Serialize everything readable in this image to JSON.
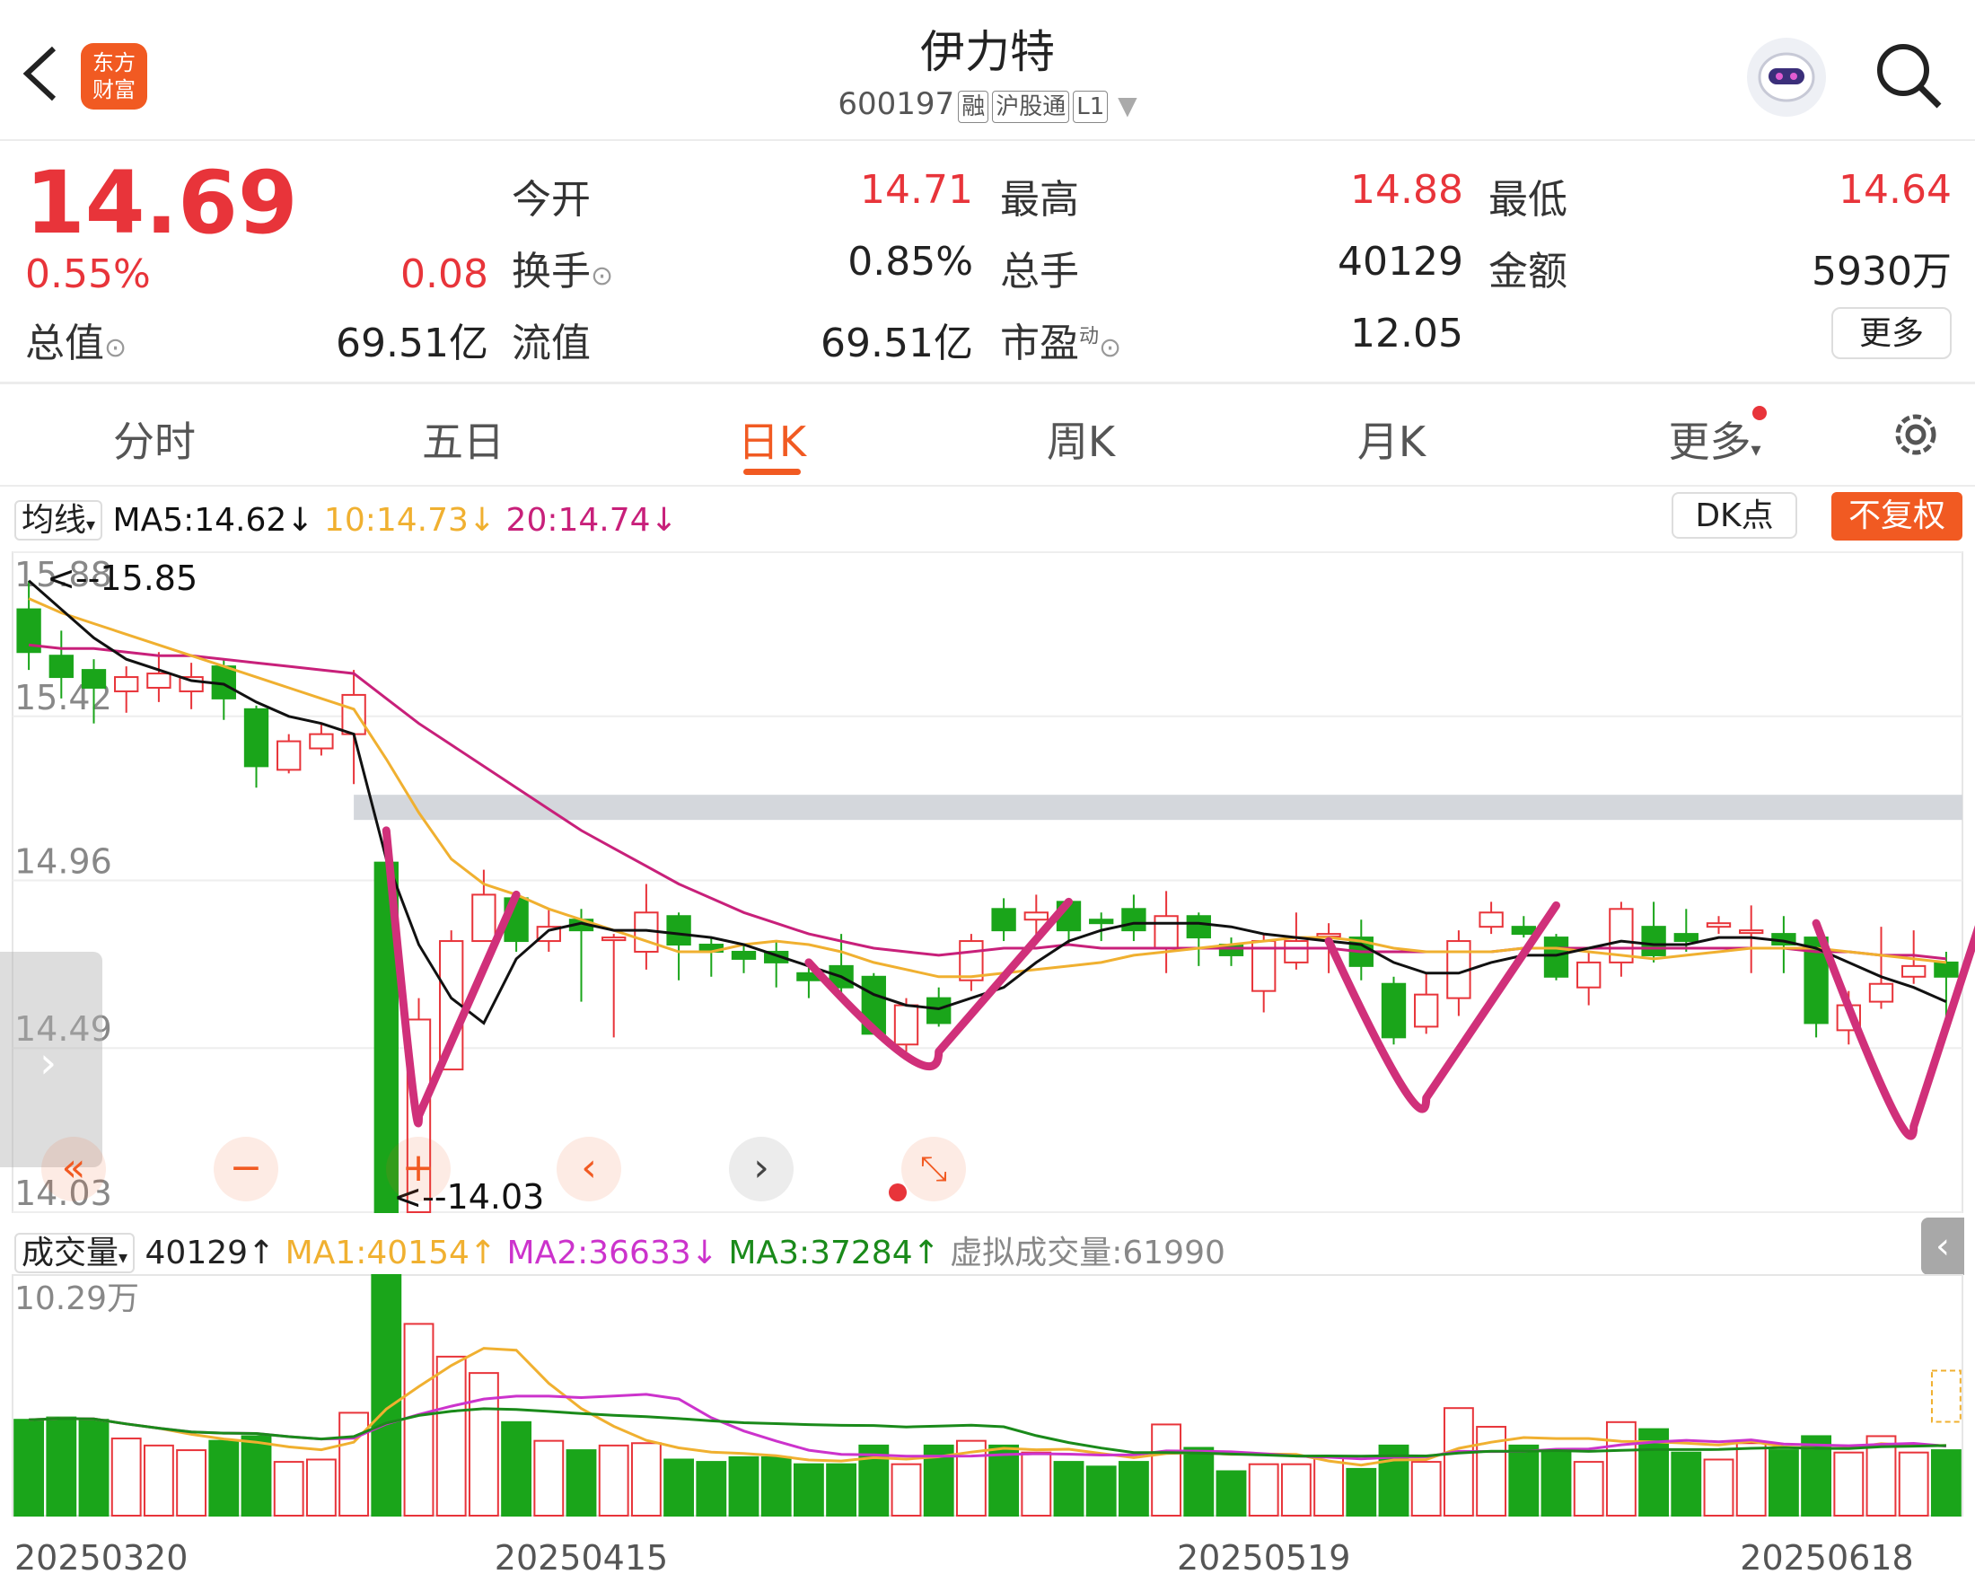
{
  "header": {
    "title": "伊力特",
    "code": "600197",
    "tags": [
      "融",
      "沪股通",
      "L1"
    ],
    "logo_text_1": "东方",
    "logo_text_2": "财富"
  },
  "quote": {
    "price": "14.69",
    "change_pct": "0.55%",
    "change": "0.08",
    "total_value_label": "总值",
    "total_value": "69.51亿",
    "fields": [
      {
        "label": "今开",
        "value": "14.71",
        "color": "red"
      },
      {
        "label": "最高",
        "value": "14.88",
        "color": "red"
      },
      {
        "label": "最低",
        "value": "14.64",
        "color": "red"
      },
      {
        "label": "换手",
        "value": "0.85%",
        "color": "dark"
      },
      {
        "label": "总手",
        "value": "40129",
        "color": "dark"
      },
      {
        "label": "金额",
        "value": "5930万",
        "color": "dark"
      },
      {
        "label": "流值",
        "value": "69.51亿",
        "color": "dark"
      },
      {
        "label": "市盈",
        "value": "12.05",
        "color": "dark"
      }
    ],
    "pe_superscript": "动",
    "more_button": "更多"
  },
  "tabs": [
    {
      "label": "分时",
      "active": false
    },
    {
      "label": "五日",
      "active": false
    },
    {
      "label": "日K",
      "active": true
    },
    {
      "label": "周K",
      "active": false
    },
    {
      "label": "月K",
      "active": false
    },
    {
      "label": "更多",
      "active": false
    }
  ],
  "kline_legend": {
    "selector": "均线",
    "ma5": "MA5:14.62↓",
    "ma10": "10:14.73↓",
    "ma20": "20:14.74↓",
    "dk_button": "DK点",
    "adjust_button": "不复权"
  },
  "volume_legend": {
    "selector": "成交量",
    "vol": "40129↑",
    "ma1": "MA1:40154↑",
    "ma2": "MA2:36633↓",
    "ma3": "MA3:37284↑",
    "virtual": "虚拟成交量:61990"
  },
  "colors": {
    "up": "#e8343a",
    "down": "#1aa51a",
    "ma5": "#111111",
    "ma10": "#f0b030",
    "ma20": "#c8207a",
    "vol_ma2": "#cc33cc",
    "accent": "#f15a22",
    "annotation": "#d0307a"
  },
  "chart_data": {
    "type": "candlestick",
    "y_ticks": [
      "15.88",
      "15.42",
      "14.96",
      "14.49",
      "14.03"
    ],
    "ylim": [
      14.03,
      15.88
    ],
    "high_marker": "15.85",
    "low_marker": "14.03",
    "volume_max_label": "10.29万",
    "volume_max": 102900,
    "dates": [
      "20250320",
      "20250415",
      "20250519",
      "20250618"
    ],
    "candles": [
      {
        "o": 15.72,
        "c": 15.6,
        "h": 15.8,
        "l": 15.55,
        "v": 41000
      },
      {
        "o": 15.59,
        "c": 15.53,
        "h": 15.66,
        "l": 15.47,
        "v": 42000
      },
      {
        "o": 15.55,
        "c": 15.5,
        "h": 15.58,
        "l": 15.4,
        "v": 41000
      },
      {
        "o": 15.49,
        "c": 15.53,
        "h": 15.56,
        "l": 15.43,
        "v": 33000
      },
      {
        "o": 15.5,
        "c": 15.54,
        "h": 15.6,
        "l": 15.46,
        "v": 30000
      },
      {
        "o": 15.49,
        "c": 15.53,
        "h": 15.57,
        "l": 15.44,
        "v": 28000
      },
      {
        "o": 15.56,
        "c": 15.47,
        "h": 15.58,
        "l": 15.41,
        "v": 32000
      },
      {
        "o": 15.44,
        "c": 15.28,
        "h": 15.45,
        "l": 15.22,
        "v": 34000
      },
      {
        "o": 15.27,
        "c": 15.35,
        "h": 15.37,
        "l": 15.26,
        "v": 23000
      },
      {
        "o": 15.33,
        "c": 15.37,
        "h": 15.4,
        "l": 15.31,
        "v": 24000
      },
      {
        "o": 15.37,
        "c": 15.48,
        "h": 15.55,
        "l": 15.23,
        "v": 44000
      },
      {
        "o": 15.01,
        "c": 14.03,
        "h": 15.07,
        "l": 14.03,
        "v": 102900
      },
      {
        "o": 14.03,
        "c": 14.57,
        "h": 14.63,
        "l": 14.03,
        "v": 82000
      },
      {
        "o": 14.43,
        "c": 14.79,
        "h": 14.82,
        "l": 14.43,
        "v": 68000
      },
      {
        "o": 14.79,
        "c": 14.92,
        "h": 14.99,
        "l": 14.79,
        "v": 61000
      },
      {
        "o": 14.91,
        "c": 14.79,
        "h": 14.93,
        "l": 14.76,
        "v": 40000
      },
      {
        "o": 14.79,
        "c": 14.83,
        "h": 14.88,
        "l": 14.76,
        "v": 32000
      },
      {
        "o": 14.85,
        "c": 14.82,
        "h": 14.88,
        "l": 14.62,
        "v": 28000
      },
      {
        "o": 14.8,
        "c": 14.8,
        "h": 14.81,
        "l": 14.52,
        "v": 30000
      },
      {
        "o": 14.76,
        "c": 14.87,
        "h": 14.95,
        "l": 14.71,
        "v": 31000
      },
      {
        "o": 14.86,
        "c": 14.78,
        "h": 14.87,
        "l": 14.68,
        "v": 24000
      },
      {
        "o": 14.78,
        "c": 14.76,
        "h": 14.8,
        "l": 14.69,
        "v": 23000
      },
      {
        "o": 14.76,
        "c": 14.74,
        "h": 14.78,
        "l": 14.7,
        "v": 25000
      },
      {
        "o": 14.76,
        "c": 14.73,
        "h": 14.79,
        "l": 14.66,
        "v": 25000
      },
      {
        "o": 14.7,
        "c": 14.68,
        "h": 14.73,
        "l": 14.63,
        "v": 22000
      },
      {
        "o": 14.72,
        "c": 14.66,
        "h": 14.81,
        "l": 14.62,
        "v": 22000
      },
      {
        "o": 14.69,
        "c": 14.53,
        "h": 14.7,
        "l": 14.53,
        "v": 30000
      },
      {
        "o": 14.5,
        "c": 14.61,
        "h": 14.63,
        "l": 14.48,
        "v": 22000
      },
      {
        "o": 14.63,
        "c": 14.56,
        "h": 14.66,
        "l": 14.55,
        "v": 30000
      },
      {
        "o": 14.68,
        "c": 14.79,
        "h": 14.81,
        "l": 14.65,
        "v": 32000
      },
      {
        "o": 14.88,
        "c": 14.82,
        "h": 14.91,
        "l": 14.79,
        "v": 30000
      },
      {
        "o": 14.85,
        "c": 14.87,
        "h": 14.92,
        "l": 14.8,
        "v": 27000
      },
      {
        "o": 14.9,
        "c": 14.82,
        "h": 14.91,
        "l": 14.78,
        "v": 23000
      },
      {
        "o": 14.85,
        "c": 14.84,
        "h": 14.87,
        "l": 14.79,
        "v": 21000
      },
      {
        "o": 14.88,
        "c": 14.82,
        "h": 14.92,
        "l": 14.79,
        "v": 23000
      },
      {
        "o": 14.77,
        "c": 14.86,
        "h": 14.93,
        "l": 14.7,
        "v": 39000
      },
      {
        "o": 14.86,
        "c": 14.8,
        "h": 14.87,
        "l": 14.72,
        "v": 29000
      },
      {
        "o": 14.78,
        "c": 14.75,
        "h": 14.8,
        "l": 14.72,
        "v": 19000
      },
      {
        "o": 14.65,
        "c": 14.79,
        "h": 14.81,
        "l": 14.59,
        "v": 22000
      },
      {
        "o": 14.73,
        "c": 14.79,
        "h": 14.87,
        "l": 14.71,
        "v": 22000
      },
      {
        "o": 14.81,
        "c": 14.81,
        "h": 14.84,
        "l": 14.7,
        "v": 25000
      },
      {
        "o": 14.8,
        "c": 14.72,
        "h": 14.85,
        "l": 14.68,
        "v": 20000
      },
      {
        "o": 14.67,
        "c": 14.52,
        "h": 14.69,
        "l": 14.5,
        "v": 30000
      },
      {
        "o": 14.55,
        "c": 14.64,
        "h": 14.7,
        "l": 14.53,
        "v": 23000
      },
      {
        "o": 14.63,
        "c": 14.79,
        "h": 14.82,
        "l": 14.58,
        "v": 46000
      },
      {
        "o": 14.83,
        "c": 14.87,
        "h": 14.9,
        "l": 14.81,
        "v": 38000
      },
      {
        "o": 14.83,
        "c": 14.81,
        "h": 14.86,
        "l": 14.8,
        "v": 30000
      },
      {
        "o": 14.8,
        "c": 14.69,
        "h": 14.81,
        "l": 14.68,
        "v": 28000
      },
      {
        "o": 14.66,
        "c": 14.73,
        "h": 14.76,
        "l": 14.61,
        "v": 23000
      },
      {
        "o": 14.73,
        "c": 14.88,
        "h": 14.9,
        "l": 14.69,
        "v": 40000
      },
      {
        "o": 14.83,
        "c": 14.75,
        "h": 14.9,
        "l": 14.73,
        "v": 37000
      },
      {
        "o": 14.81,
        "c": 14.79,
        "h": 14.88,
        "l": 14.76,
        "v": 27000
      },
      {
        "o": 14.83,
        "c": 14.84,
        "h": 14.86,
        "l": 14.81,
        "v": 24000
      },
      {
        "o": 14.82,
        "c": 14.82,
        "h": 14.89,
        "l": 14.7,
        "v": 31000
      },
      {
        "o": 14.81,
        "c": 14.78,
        "h": 14.86,
        "l": 14.7,
        "v": 28000
      },
      {
        "o": 14.8,
        "c": 14.56,
        "h": 14.8,
        "l": 14.52,
        "v": 34000
      },
      {
        "o": 14.54,
        "c": 14.61,
        "h": 14.65,
        "l": 14.5,
        "v": 27000
      },
      {
        "o": 14.62,
        "c": 14.67,
        "h": 14.83,
        "l": 14.6,
        "v": 34000
      },
      {
        "o": 14.69,
        "c": 14.72,
        "h": 14.82,
        "l": 14.67,
        "v": 27000
      },
      {
        "o": 14.73,
        "c": 14.69,
        "h": 14.76,
        "l": 14.57,
        "v": 28000
      }
    ],
    "ma5": [
      15.8,
      15.72,
      15.64,
      15.58,
      15.55,
      15.52,
      15.51,
      15.46,
      15.42,
      15.4,
      15.37,
      15.02,
      14.78,
      14.63,
      14.56,
      14.74,
      14.82,
      14.84,
      14.82,
      14.82,
      14.81,
      14.8,
      14.78,
      14.75,
      14.72,
      14.69,
      14.64,
      14.61,
      14.6,
      14.63,
      14.66,
      14.73,
      14.79,
      14.82,
      14.84,
      14.84,
      14.84,
      14.83,
      14.81,
      14.8,
      14.79,
      14.78,
      14.73,
      14.7,
      14.7,
      14.73,
      14.75,
      14.75,
      14.77,
      14.79,
      14.78,
      14.78,
      14.8,
      14.8,
      14.79,
      14.77,
      14.73,
      14.69,
      14.66,
      14.62
    ],
    "ma10": [
      15.75,
      15.71,
      15.68,
      15.65,
      15.62,
      15.59,
      15.56,
      15.53,
      15.5,
      15.47,
      15.44,
      15.3,
      15.15,
      15.02,
      14.95,
      14.92,
      14.88,
      14.85,
      14.82,
      14.79,
      14.76,
      14.76,
      14.78,
      14.79,
      14.78,
      14.76,
      14.73,
      14.71,
      14.69,
      14.69,
      14.7,
      14.71,
      14.72,
      14.73,
      14.75,
      14.76,
      14.77,
      14.78,
      14.79,
      14.8,
      14.8,
      14.79,
      14.77,
      14.76,
      14.76,
      14.76,
      14.77,
      14.77,
      14.76,
      14.75,
      14.74,
      14.75,
      14.76,
      14.77,
      14.77,
      14.77,
      14.76,
      14.75,
      14.74,
      14.73
    ],
    "ma20": [
      15.62,
      15.61,
      15.61,
      15.6,
      15.59,
      15.59,
      15.58,
      15.57,
      15.56,
      15.55,
      15.54,
      15.47,
      15.4,
      15.34,
      15.28,
      15.22,
      15.16,
      15.1,
      15.05,
      15.0,
      14.95,
      14.91,
      14.87,
      14.84,
      14.81,
      14.79,
      14.77,
      14.76,
      14.75,
      14.76,
      14.77,
      14.77,
      14.78,
      14.77,
      14.77,
      14.77,
      14.77,
      14.77,
      14.77,
      14.77,
      14.77,
      14.76,
      14.76,
      14.76,
      14.76,
      14.76,
      14.77,
      14.77,
      14.77,
      14.77,
      14.77,
      14.77,
      14.77,
      14.77,
      14.77,
      14.76,
      14.76,
      14.75,
      14.75,
      14.74
    ]
  }
}
